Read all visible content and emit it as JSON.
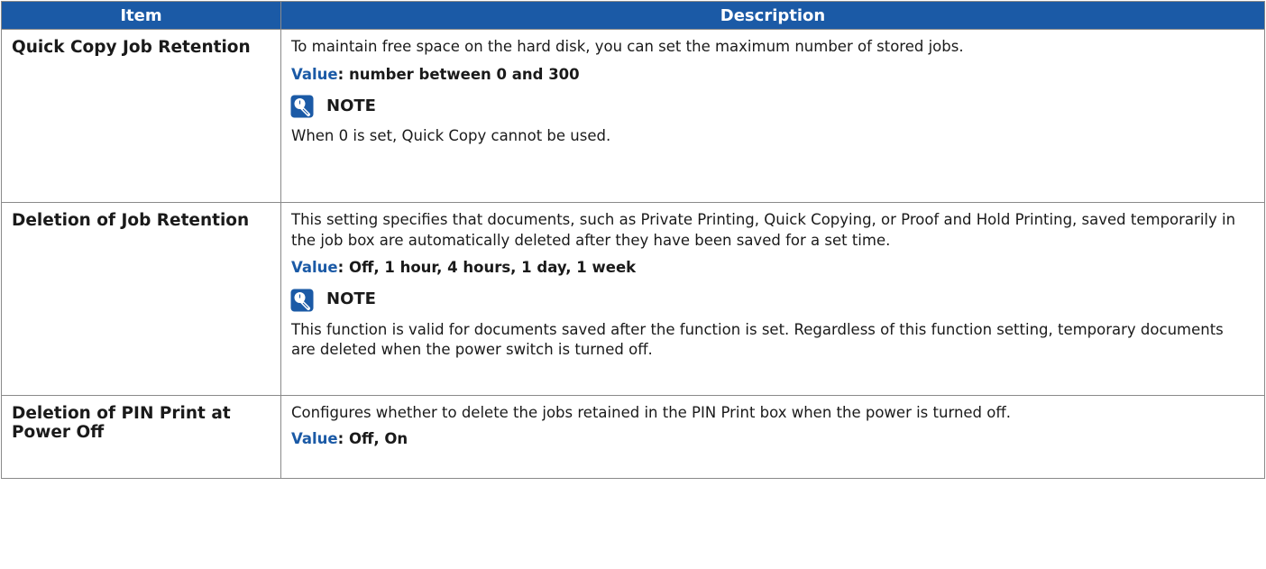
{
  "header": {
    "item": "Item",
    "description": "Description"
  },
  "rows": [
    {
      "item": "Quick Copy Job Retention",
      "desc": "To maintain free space on the hard disk, you can set the maximum number of stored jobs.",
      "value_label": "Value",
      "value_text": ": number between 0 and 300",
      "note_title": "NOTE",
      "note_text": "When 0 is set, Quick Copy cannot be used."
    },
    {
      "item": "Deletion of Job Retention",
      "desc": "This setting specifies that documents, such as Private Printing, Quick Copying, or Proof and Hold Printing, saved temporarily in the job box are automatically deleted after they have been saved for a set time.",
      "value_label": "Value",
      "value_text": ": Off, 1 hour, 4 hours, 1 day, 1 week",
      "note_title": "NOTE",
      "note_text": "This function is valid for documents saved after the function is set. Regardless of this function setting, temporary documents are deleted when the power switch is turned off."
    },
    {
      "item": "Deletion of PIN Print at Power Off",
      "desc": "Configures whether to delete the jobs retained in the PIN Print box when the power is turned off.",
      "value_label": "Value",
      "value_text": ": Off, On"
    }
  ],
  "colors": {
    "header_bg": "#1b5aa6",
    "value_label": "#1b5aa6",
    "note_icon": "#1b5aa6"
  },
  "icons": {
    "note": "note-lightbulb-icon"
  }
}
